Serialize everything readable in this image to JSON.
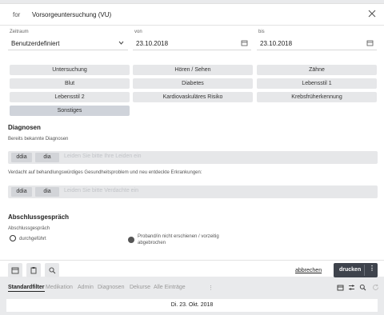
{
  "header": {
    "for_label": "for",
    "title": "Vorsorgeuntersuchung (VU)"
  },
  "period": {
    "zeitraum_label": "Zeitraum",
    "zeitraum_value": "Benutzerdefiniert",
    "von_label": "von",
    "von_value": "23.10.2018",
    "bis_label": "bis",
    "bis_value": "23.10.2018"
  },
  "categories": [
    {
      "label": "Untersuchung",
      "active": false
    },
    {
      "label": "Hören / Sehen",
      "active": false
    },
    {
      "label": "Zähne",
      "active": false
    },
    {
      "label": "Blut",
      "active": false
    },
    {
      "label": "Diabetes",
      "active": false
    },
    {
      "label": "Lebensstil 1",
      "active": false
    },
    {
      "label": "Lebensstil 2",
      "active": false
    },
    {
      "label": "Kardiovaskuläres Risiko",
      "active": false
    },
    {
      "label": "Krebsfrüherkennung",
      "active": false
    },
    {
      "label": "Sonstiges",
      "active": true
    }
  ],
  "diagnoses": {
    "title": "Diagnosen",
    "known_label": "Bereits bekannte Diagnosen",
    "suspect_label": "Verdacht auf behandlungswürdiges Gesundheitsproblem und neu entdeckte Erkrankungen:",
    "tag_ddia": "ddia",
    "tag_dia": "dia",
    "placeholder_known": "Leiden Sie bitte Ihre Leiden ein",
    "placeholder_suspect": "Leiden Sie bitte Verdachte ein"
  },
  "closing": {
    "title": "Abschlussgespräch",
    "sub_label": "Abschlussgespräch",
    "opt1": "durchgeführt",
    "opt2_line1": "Proband/in nicht erschienen / vorzeitig",
    "opt2_line2": "abgebrochen"
  },
  "footer": {
    "cancel": "abbrechen",
    "print": "drucken",
    "more": "⋮"
  },
  "bottom_tabs": [
    {
      "label": "Standardfilter",
      "active": true
    },
    {
      "label": "Medikation",
      "active": false
    },
    {
      "label": "Admin",
      "active": false
    },
    {
      "label": "Diagnosen",
      "active": false
    },
    {
      "label": "Dekurse",
      "active": false
    },
    {
      "label": "Alle Einträge",
      "active": false
    }
  ],
  "bottom_tabs_more": "⋮",
  "date_strip": "Di. 23. Okt. 2018",
  "colors": {
    "accent_dark": "#3e434c",
    "button_bg": "#e6e7e9",
    "active_bg": "#cfd3da"
  }
}
